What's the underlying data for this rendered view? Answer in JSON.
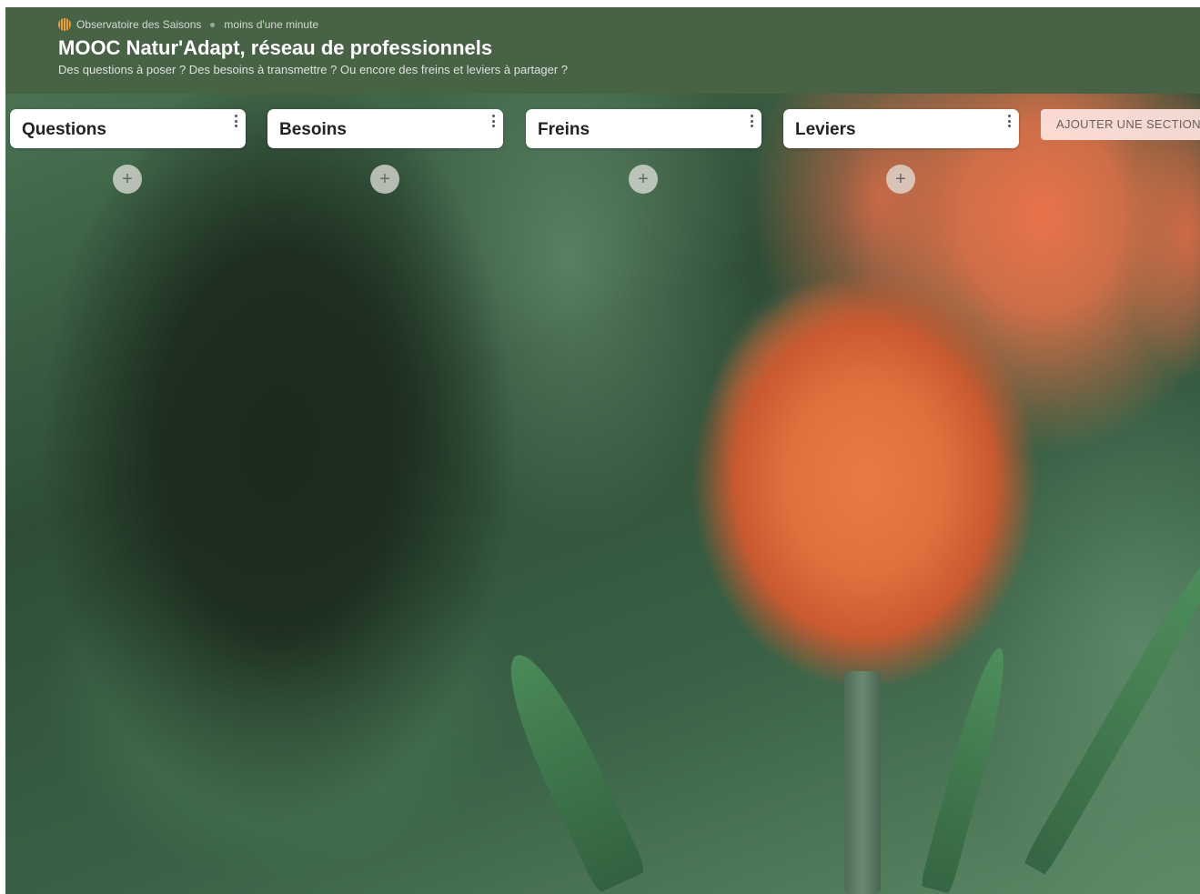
{
  "header": {
    "org_name": "Observatoire des Saisons",
    "timestamp": "moins d'une minute",
    "title": "MOOC Natur'Adapt, réseau de professionnels",
    "subtitle": "Des questions à poser ? Des besoins à transmettre ? Ou encore des freins et leviers à partager ?"
  },
  "sections": [
    {
      "title": "Questions"
    },
    {
      "title": "Besoins"
    },
    {
      "title": "Freins"
    },
    {
      "title": "Leviers"
    }
  ],
  "add_post_label": "+",
  "add_section_label": "AJOUTER UNE SECTION",
  "icons": {
    "org_logo": "org-logo-icon",
    "section_menu": "kebab-icon",
    "add_post": "plus-icon"
  },
  "colors": {
    "header_bg": "#486246",
    "section_bg": "#ffffff",
    "add_section_bg": "#fde4de"
  }
}
